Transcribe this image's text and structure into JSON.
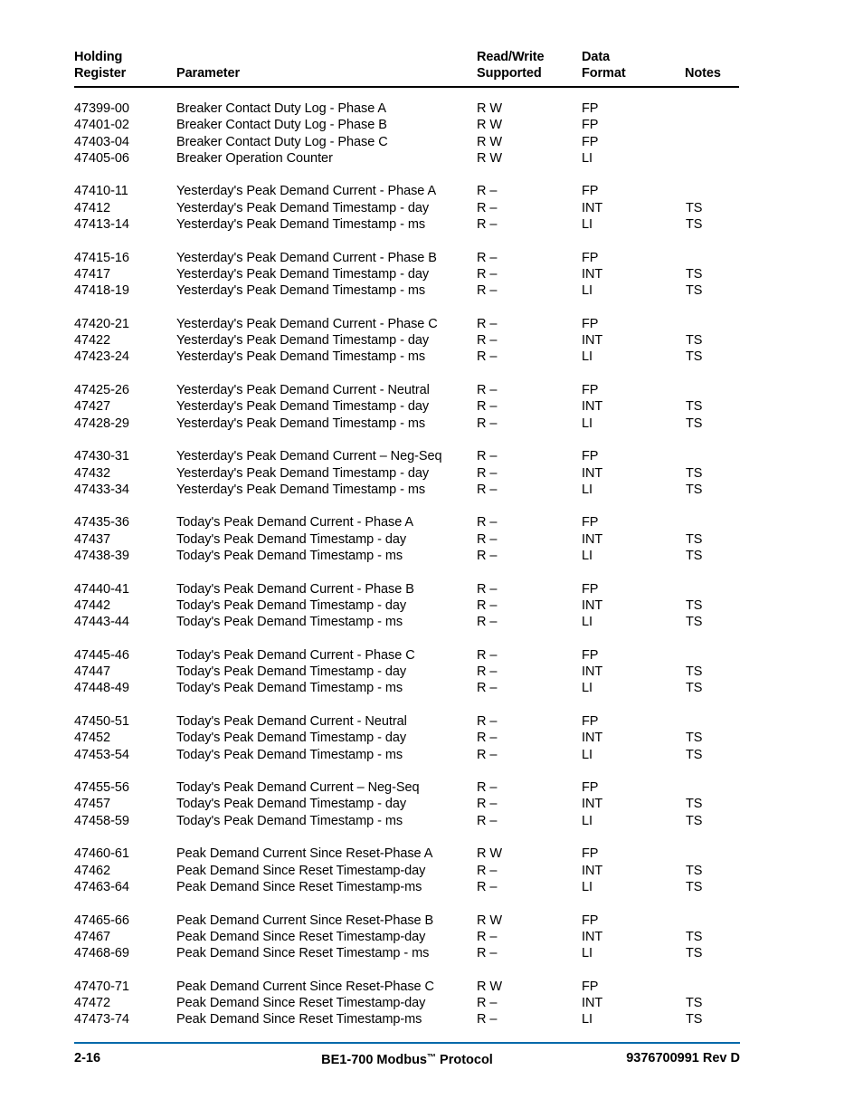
{
  "document": {
    "columns": {
      "register": "Holding\nRegister",
      "parameter": "Parameter",
      "read_write": "Read/Write\nSupported",
      "data_format": "Data\nFormat",
      "notes": "Notes"
    },
    "rule_colors": {
      "header_rule": "#000000",
      "footer_rule": "#0069aa"
    },
    "groups": [
      {
        "rows": [
          {
            "register": "47399-00",
            "parameter": "Breaker Contact Duty Log - Phase A",
            "read_write": "R W",
            "data_format": "FP",
            "notes": ""
          },
          {
            "register": "47401-02",
            "parameter": "Breaker Contact Duty Log - Phase B",
            "read_write": "R W",
            "data_format": "FP",
            "notes": ""
          },
          {
            "register": "47403-04",
            "parameter": "Breaker Contact Duty Log - Phase C",
            "read_write": "R W",
            "data_format": "FP",
            "notes": ""
          },
          {
            "register": "47405-06",
            "parameter": "Breaker Operation Counter",
            "read_write": "R W",
            "data_format": "LI",
            "notes": ""
          }
        ]
      },
      {
        "rows": [
          {
            "register": "47410-11",
            "parameter": "Yesterday's Peak Demand Current - Phase A",
            "read_write": "R –",
            "data_format": "FP",
            "notes": ""
          },
          {
            "register": "47412",
            "parameter": "Yesterday's Peak Demand Timestamp - day",
            "read_write": "R –",
            "data_format": "INT",
            "notes": "TS"
          },
          {
            "register": "47413-14",
            "parameter": "Yesterday's Peak Demand Timestamp - ms",
            "read_write": "R –",
            "data_format": "LI",
            "notes": "TS"
          }
        ]
      },
      {
        "rows": [
          {
            "register": "47415-16",
            "parameter": "Yesterday's Peak Demand Current - Phase B",
            "read_write": "R –",
            "data_format": "FP",
            "notes": ""
          },
          {
            "register": "47417",
            "parameter": "Yesterday's Peak Demand Timestamp - day",
            "read_write": "R –",
            "data_format": "INT",
            "notes": "TS"
          },
          {
            "register": "47418-19",
            "parameter": "Yesterday's Peak Demand Timestamp - ms",
            "read_write": "R –",
            "data_format": "LI",
            "notes": "TS"
          }
        ]
      },
      {
        "rows": [
          {
            "register": "47420-21",
            "parameter": "Yesterday's Peak Demand Current - Phase C",
            "read_write": "R –",
            "data_format": "FP",
            "notes": ""
          },
          {
            "register": "47422",
            "parameter": "Yesterday's Peak Demand Timestamp - day",
            "read_write": "R –",
            "data_format": "INT",
            "notes": "TS"
          },
          {
            "register": "47423-24",
            "parameter": "Yesterday's Peak Demand Timestamp - ms",
            "read_write": "R –",
            "data_format": "LI",
            "notes": "TS"
          }
        ]
      },
      {
        "rows": [
          {
            "register": "47425-26",
            "parameter": "Yesterday's Peak Demand Current - Neutral",
            "read_write": "R –",
            "data_format": "FP",
            "notes": ""
          },
          {
            "register": "47427",
            "parameter": "Yesterday's Peak Demand Timestamp - day",
            "read_write": "R –",
            "data_format": "INT",
            "notes": "TS"
          },
          {
            "register": "47428-29",
            "parameter": "Yesterday's Peak Demand Timestamp - ms",
            "read_write": "R –",
            "data_format": "LI",
            "notes": "TS"
          }
        ]
      },
      {
        "rows": [
          {
            "register": "47430-31",
            "parameter": "Yesterday's Peak Demand Current – Neg-Seq",
            "read_write": "R –",
            "data_format": "FP",
            "notes": ""
          },
          {
            "register": "47432",
            "parameter": "Yesterday's Peak Demand Timestamp - day",
            "read_write": "R –",
            "data_format": "INT",
            "notes": "TS"
          },
          {
            "register": "47433-34",
            "parameter": "Yesterday's Peak Demand Timestamp - ms",
            "read_write": "R –",
            "data_format": "LI",
            "notes": "TS"
          }
        ]
      },
      {
        "rows": [
          {
            "register": "47435-36",
            "parameter": "Today's Peak Demand Current - Phase A",
            "read_write": "R –",
            "data_format": "FP",
            "notes": ""
          },
          {
            "register": "47437",
            "parameter": "Today's Peak Demand Timestamp - day",
            "read_write": "R –",
            "data_format": "INT",
            "notes": "TS"
          },
          {
            "register": "47438-39",
            "parameter": "Today's Peak Demand Timestamp - ms",
            "read_write": "R –",
            "data_format": "LI",
            "notes": "TS"
          }
        ]
      },
      {
        "rows": [
          {
            "register": "47440-41",
            "parameter": "Today's Peak Demand Current - Phase B",
            "read_write": "R –",
            "data_format": "FP",
            "notes": ""
          },
          {
            "register": "47442",
            "parameter": "Today's Peak Demand Timestamp - day",
            "read_write": "R –",
            "data_format": "INT",
            "notes": "TS"
          },
          {
            "register": "47443-44",
            "parameter": "Today's Peak Demand Timestamp - ms",
            "read_write": "R –",
            "data_format": "LI",
            "notes": "TS"
          }
        ]
      },
      {
        "rows": [
          {
            "register": "47445-46",
            "parameter": "Today's Peak Demand Current - Phase C",
            "read_write": "R –",
            "data_format": "FP",
            "notes": ""
          },
          {
            "register": "47447",
            "parameter": "Today's Peak Demand Timestamp - day",
            "read_write": "R –",
            "data_format": "INT",
            "notes": "TS"
          },
          {
            "register": "47448-49",
            "parameter": "Today's Peak Demand Timestamp - ms",
            "read_write": "R –",
            "data_format": "LI",
            "notes": "TS"
          }
        ]
      },
      {
        "rows": [
          {
            "register": "47450-51",
            "parameter": "Today's Peak Demand Current - Neutral",
            "read_write": "R –",
            "data_format": "FP",
            "notes": ""
          },
          {
            "register": "47452",
            "parameter": "Today's Peak Demand Timestamp - day",
            "read_write": "R –",
            "data_format": "INT",
            "notes": "TS"
          },
          {
            "register": "47453-54",
            "parameter": "Today's Peak Demand Timestamp - ms",
            "read_write": "R –",
            "data_format": "LI",
            "notes": "TS"
          }
        ]
      },
      {
        "rows": [
          {
            "register": "47455-56",
            "parameter": "Today's Peak Demand Current – Neg-Seq",
            "read_write": "R –",
            "data_format": "FP",
            "notes": ""
          },
          {
            "register": "47457",
            "parameter": "Today's Peak Demand Timestamp - day",
            "read_write": "R –",
            "data_format": "INT",
            "notes": "TS"
          },
          {
            "register": "47458-59",
            "parameter": "Today's Peak Demand Timestamp - ms",
            "read_write": "R –",
            "data_format": "LI",
            "notes": "TS"
          }
        ]
      },
      {
        "rows": [
          {
            "register": "47460-61",
            "parameter": "Peak Demand Current Since Reset-Phase A",
            "read_write": "R W",
            "data_format": "FP",
            "notes": ""
          },
          {
            "register": "47462",
            "parameter": "Peak Demand Since Reset Timestamp-day",
            "read_write": "R –",
            "data_format": "INT",
            "notes": "TS"
          },
          {
            "register": "47463-64",
            "parameter": "Peak Demand Since Reset Timestamp-ms",
            "read_write": "R –",
            "data_format": "LI",
            "notes": "TS"
          }
        ]
      },
      {
        "rows": [
          {
            "register": "47465-66",
            "parameter": "Peak Demand Current Since Reset-Phase B",
            "read_write": "R W",
            "data_format": "FP",
            "notes": ""
          },
          {
            "register": "47467",
            "parameter": "Peak Demand Since Reset Timestamp-day",
            "read_write": "R –",
            "data_format": "INT",
            "notes": "TS"
          },
          {
            "register": "47468-69",
            "parameter": "Peak Demand Since Reset Timestamp - ms",
            "read_write": "R –",
            "data_format": "LI",
            "notes": "TS"
          }
        ]
      },
      {
        "rows": [
          {
            "register": "47470-71",
            "parameter": "Peak Demand Current Since Reset-Phase C",
            "read_write": "R W",
            "data_format": "FP",
            "notes": ""
          },
          {
            "register": "47472",
            "parameter": "Peak Demand Since Reset Timestamp-day",
            "read_write": "R –",
            "data_format": "INT",
            "notes": "TS"
          },
          {
            "register": "47473-74",
            "parameter": "Peak Demand Since Reset Timestamp-ms",
            "read_write": "R –",
            "data_format": "LI",
            "notes": "TS"
          }
        ]
      }
    ],
    "footer": {
      "page_number": "2-16",
      "title_before_tm": "BE1-700 Modbus",
      "trademark": "™",
      "title_after_tm": " Protocol",
      "document_number": "9376700991 Rev D"
    }
  }
}
